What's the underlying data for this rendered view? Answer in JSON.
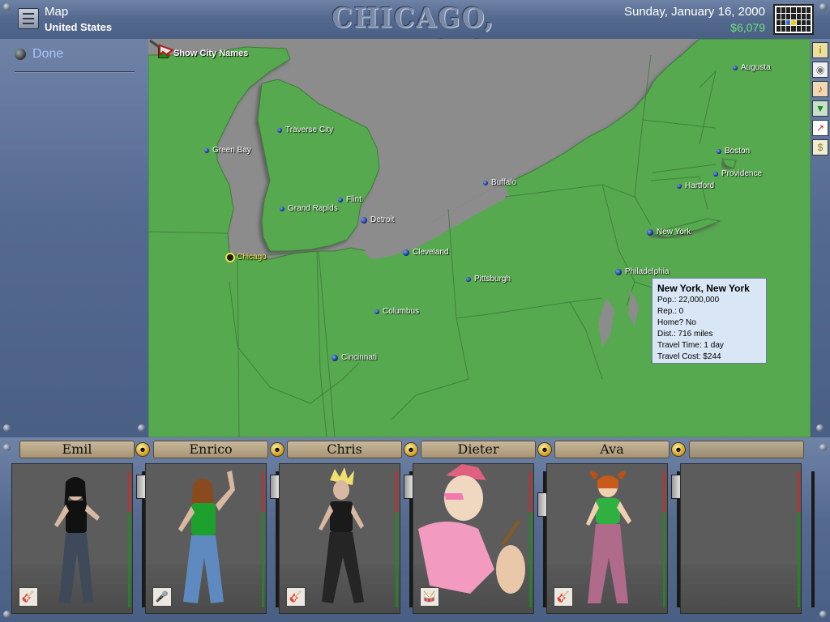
{
  "header": {
    "screen_title": "Map",
    "screen_subtitle": "United States",
    "city_title": "CHICAGO, ILLINOIS",
    "date": "Sunday, January 16, 2000",
    "money": "$6,079"
  },
  "sidebar": {
    "done_label": "Done"
  },
  "map": {
    "show_names_label": "Show City Names",
    "land_color": "#56a94f",
    "water_color": "#8c8c8c",
    "cities": [
      {
        "name": "Augusta",
        "current": false
      },
      {
        "name": "Traverse City",
        "current": false
      },
      {
        "name": "Green Bay",
        "current": false
      },
      {
        "name": "Boston",
        "current": false
      },
      {
        "name": "Providence",
        "current": false
      },
      {
        "name": "Buffalo",
        "current": false
      },
      {
        "name": "Hartford",
        "current": false
      },
      {
        "name": "Flint",
        "current": false
      },
      {
        "name": "Grand Rapids",
        "current": false
      },
      {
        "name": "Detroit",
        "current": false
      },
      {
        "name": "New York",
        "current": false
      },
      {
        "name": "Chicago",
        "current": true
      },
      {
        "name": "Cleveland",
        "current": false
      },
      {
        "name": "Philadelphia",
        "current": false
      },
      {
        "name": "Pittsburgh",
        "current": false
      },
      {
        "name": "Columbus",
        "current": false
      },
      {
        "name": "Cincinnati",
        "current": false
      }
    ],
    "tooltip": {
      "title": "New York, New York",
      "pop": "Pop.: 22,000,000",
      "rep": "Rep.: 0",
      "home": "Home? No",
      "dist": "Dist.: 716 miles",
      "travel_time": "Travel Time: 1 day",
      "travel_cost": "Travel Cost: $244"
    }
  },
  "right_toolbar": [
    "info-icon",
    "cd-icon",
    "music-note-icon",
    "tie-icon",
    "chart-icon",
    "money-icon"
  ],
  "band": {
    "members": [
      {
        "name": "Emil",
        "instrument": "guitar-icon"
      },
      {
        "name": "Enrico",
        "instrument": "microphone-icon"
      },
      {
        "name": "Chris",
        "instrument": "bass-guitar-icon"
      },
      {
        "name": "Dieter",
        "instrument": "drum-icon"
      },
      {
        "name": "Ava",
        "instrument": "guitar-icon"
      }
    ]
  }
}
